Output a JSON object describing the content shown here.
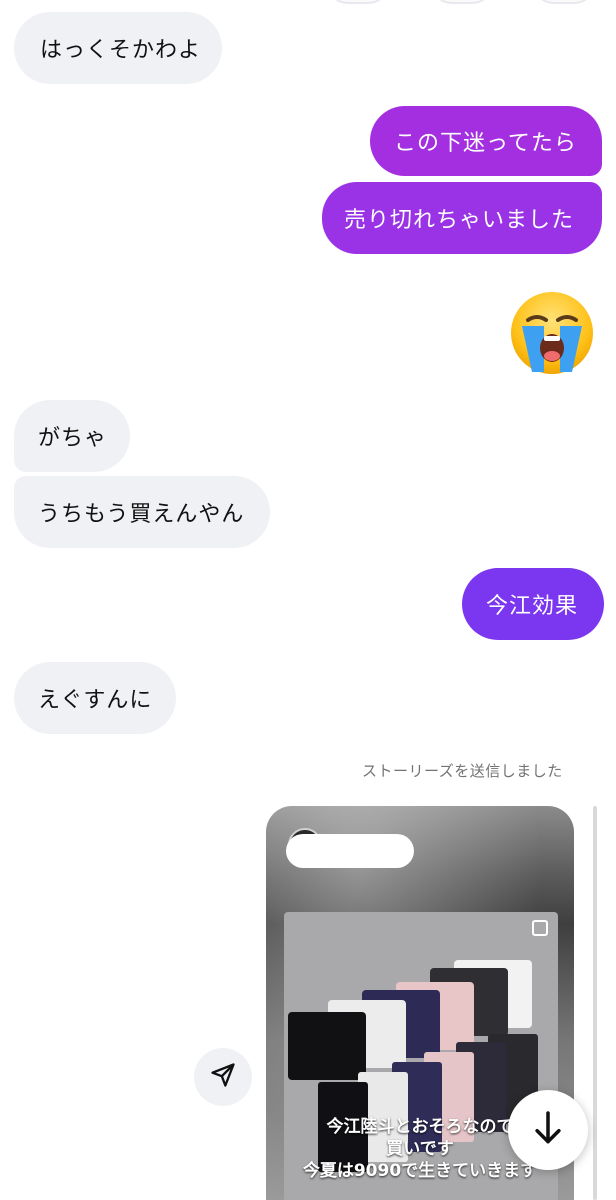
{
  "messages": [
    {
      "id": "m1",
      "direction": "received",
      "text": "はっくそかわよ"
    },
    {
      "id": "m2",
      "direction": "sent",
      "text": "この下迷ってたら"
    },
    {
      "id": "m3",
      "direction": "sent",
      "text": "売り切れちゃいました"
    },
    {
      "id": "m4",
      "direction": "received",
      "text": "がちゃ"
    },
    {
      "id": "m5",
      "direction": "received",
      "text": "うちもう買えんやん"
    },
    {
      "id": "m6",
      "direction": "sent",
      "text": "今江効果"
    },
    {
      "id": "m7",
      "direction": "received",
      "text": "えぐすんに"
    }
  ],
  "emoji_message": {
    "emoji": "loudly-crying-face"
  },
  "story_share": {
    "caption": "ストーリーズを送信しました",
    "overlay_lines": [
      "今江陸斗とおそろなので",
      "買いです",
      "今夏は9090で生きていきます"
    ]
  },
  "icons": {
    "share": "send-icon",
    "scroll_down": "arrow-down-icon"
  },
  "colors": {
    "sent_1": "#a32fe0",
    "sent_2": "#9a33e6",
    "sent_3": "#7b36f0",
    "received": "#eff1f4"
  }
}
